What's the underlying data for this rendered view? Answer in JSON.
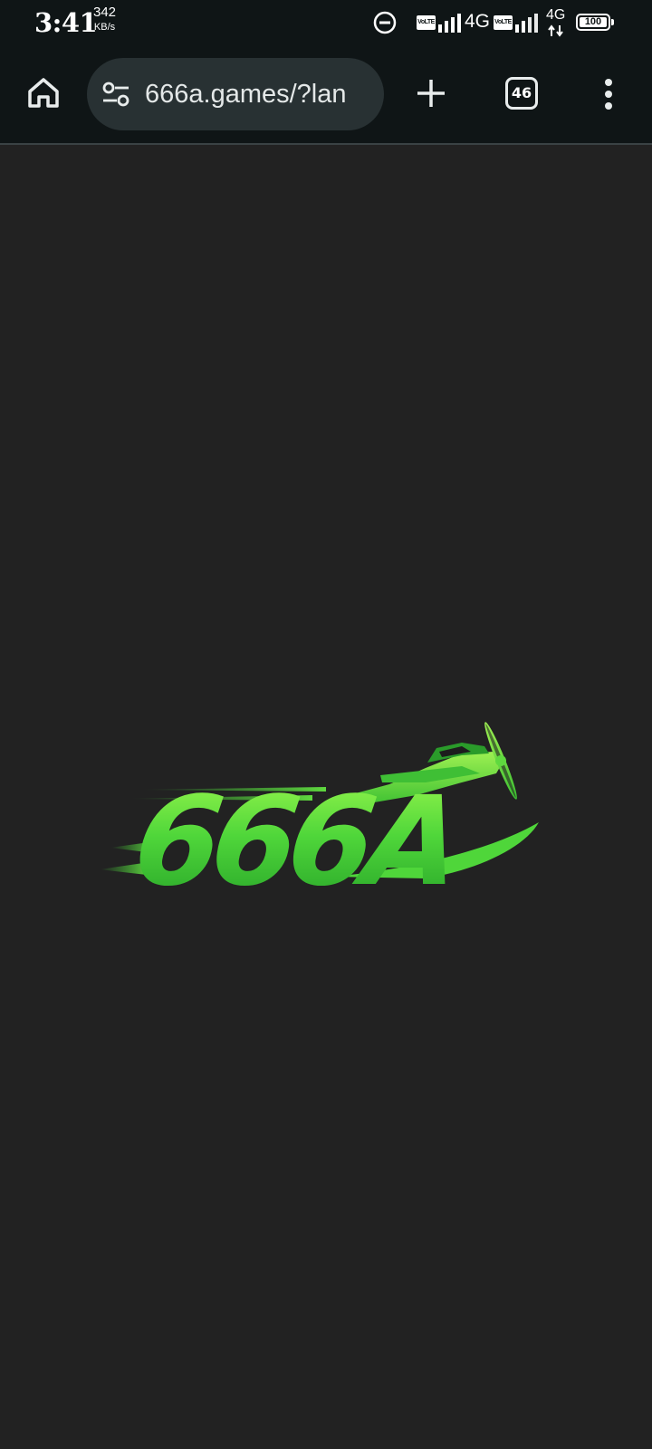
{
  "status_bar": {
    "time": "3:41",
    "net_speed_value": "342",
    "net_speed_unit": "KB/s",
    "sim1_label": "VoLTE",
    "sim1_network": "4G",
    "sim2_label": "VoLTE",
    "sim2_network": "4G",
    "battery": "100",
    "icons": [
      "dnd-icon",
      "signal-icon",
      "data-arrows-icon",
      "battery-icon"
    ]
  },
  "browser": {
    "url": "666a.games/?lan",
    "tab_count": "46",
    "icons": [
      "home-icon",
      "site-settings-icon",
      "new-tab-icon",
      "tab-switcher-icon",
      "menu-icon"
    ]
  },
  "page": {
    "logo_text": "666A",
    "logo_icon": "airplane-icon",
    "background_color": "#222222",
    "accent_color": "#4fd63a"
  }
}
